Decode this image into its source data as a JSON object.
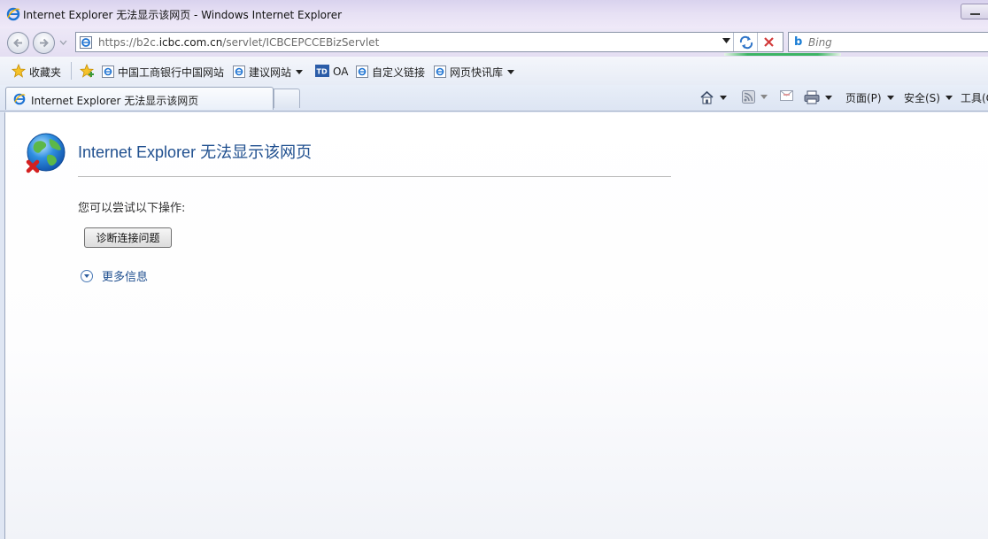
{
  "window": {
    "title": "Internet Explorer 无法显示该网页 - Windows Internet Explorer"
  },
  "navbar": {
    "url_prefix": "https://b2c.",
    "url_domain": "icbc.com.cn",
    "url_path": "/servlet/ICBCEPCCEBizServlet",
    "search_placeholder": "Bing"
  },
  "favorites": {
    "label": "收藏夹",
    "items": [
      {
        "label": "中国工商银行中国网站",
        "icon": "ie-page-icon",
        "has_dropdown": false
      },
      {
        "label": "建议网站",
        "icon": "ie-page-icon",
        "has_dropdown": true
      },
      {
        "label": "OA",
        "icon": "td-icon",
        "has_dropdown": false
      },
      {
        "label": "自定义链接",
        "icon": "ie-page-icon",
        "has_dropdown": false
      },
      {
        "label": "网页快讯库",
        "icon": "ie-page-icon",
        "has_dropdown": true
      }
    ]
  },
  "tab": {
    "label": "Internet Explorer 无法显示该网页"
  },
  "commandbar": {
    "page": "页面(P)",
    "safety": "安全(S)",
    "tools": "工具(O)"
  },
  "content": {
    "title": "Internet Explorer 无法显示该网页",
    "try_text": "您可以尝试以下操作:",
    "diagnose_button": "诊断连接问题",
    "more_info": "更多信息"
  },
  "colors": {
    "title_blue": "#1f4f8f",
    "titlebar": "#e6e0f4",
    "load_bar_green": "#3cb464"
  }
}
